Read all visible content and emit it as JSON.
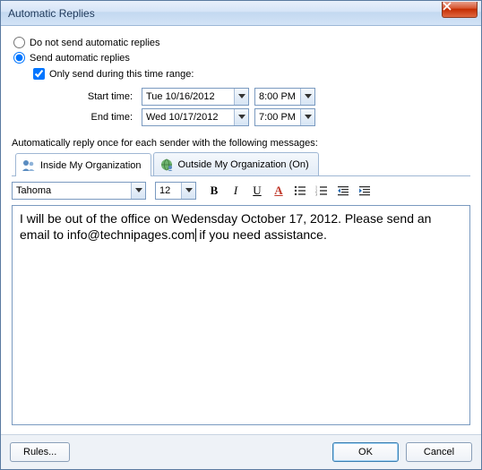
{
  "window": {
    "title": "Automatic Replies"
  },
  "options": {
    "dont_send_label": "Do not send automatic replies",
    "send_label": "Send automatic replies",
    "selected": "send",
    "only_send_label": "Only send during this time range:",
    "only_send_checked": true,
    "start_label": "Start time:",
    "end_label": "End time:",
    "start_date": "Tue 10/16/2012",
    "start_time": "8:00 PM",
    "end_date": "Wed 10/17/2012",
    "end_time": "7:00 PM"
  },
  "section_label": "Automatically reply once for each sender with the following messages:",
  "tabs": {
    "inside": "Inside My Organization",
    "outside": "Outside My Organization (On)",
    "active": "inside"
  },
  "format": {
    "font": "Tahoma",
    "size": "12"
  },
  "editor": {
    "before_caret": "I will be out of the office on Wedensday October 17, 2012. Please send an email to info@technipages.com",
    "after_caret": " if you need assistance."
  },
  "buttons": {
    "rules": "Rules...",
    "ok": "OK",
    "cancel": "Cancel"
  }
}
